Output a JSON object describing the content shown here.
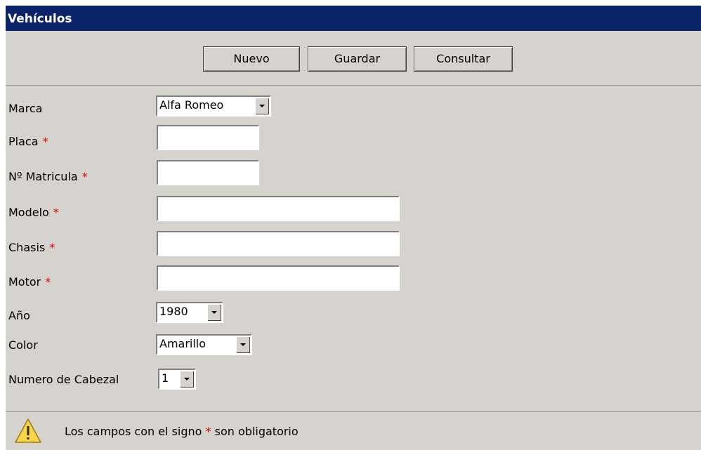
{
  "header": {
    "title": "Vehículos"
  },
  "toolbar": {
    "nuevo": "Nuevo",
    "guardar": "Guardar",
    "consultar": "Consultar"
  },
  "form": {
    "required_mark": "*",
    "marca": {
      "label": "Marca",
      "value": "Alfa Romeo"
    },
    "placa": {
      "label": "Placa",
      "value": ""
    },
    "matricula": {
      "label": "Nº Matricula",
      "value": ""
    },
    "modelo": {
      "label": "Modelo",
      "value": ""
    },
    "chasis": {
      "label": "Chasis",
      "value": ""
    },
    "motor": {
      "label": "Motor",
      "value": ""
    },
    "anio": {
      "label": "Año",
      "value": "1980"
    },
    "color": {
      "label": "Color",
      "value": "Amarillo"
    },
    "cabezal": {
      "label": "Numero de Cabezal",
      "value": "1"
    }
  },
  "footer": {
    "text_before": "Los campos con el signo",
    "mark": "*",
    "text_after": "son obligatorio",
    "icon": "warning-icon"
  },
  "colors": {
    "title_bar": "#0a246a",
    "panel": "#d6d3ce",
    "required": "#e00000"
  }
}
